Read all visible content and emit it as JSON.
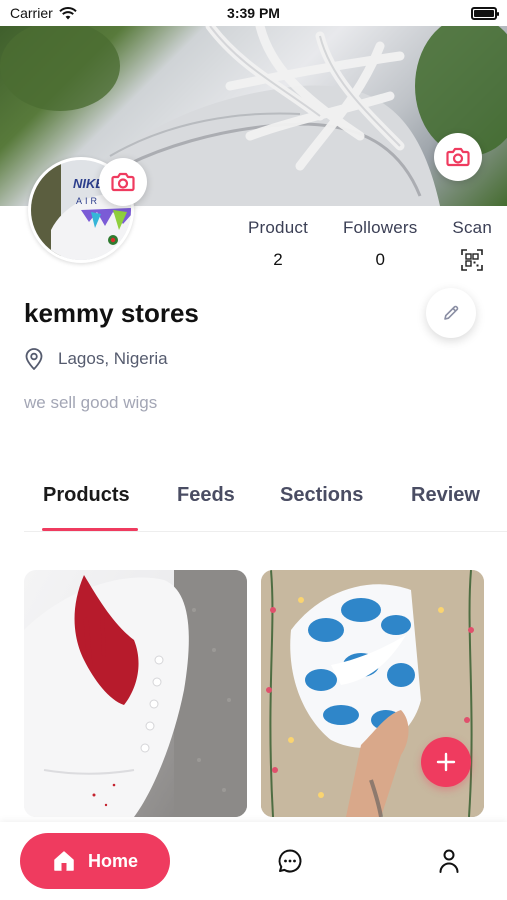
{
  "status_bar": {
    "carrier": "Carrier",
    "time": "3:39 PM"
  },
  "profile": {
    "store_name": "kemmy stores",
    "location": "Lagos, Nigeria",
    "bio": "we sell good wigs",
    "avatar_brand_text": "NIKE AIR"
  },
  "stats": [
    {
      "label": "Product",
      "value": "2"
    },
    {
      "label": "Followers",
      "value": "0"
    },
    {
      "label": "Scan",
      "icon": "qr-scan-icon"
    }
  ],
  "tabs": [
    {
      "label": "Products",
      "active": true
    },
    {
      "label": "Feeds",
      "active": false
    },
    {
      "label": "Sections",
      "active": false
    },
    {
      "label": "Review",
      "active": false
    }
  ],
  "products": [
    {
      "image": "white-sneaker-red-swoosh"
    },
    {
      "image": "blue-cloud-high-top-sneaker"
    }
  ],
  "bottom_nav": {
    "home_label": "Home",
    "items": [
      "home-icon",
      "chat-icon",
      "profile-icon"
    ]
  },
  "colors": {
    "accent": "#ef3b5f",
    "text_primary": "#111111",
    "text_secondary": "#3b3f55",
    "text_muted": "#a3a6b5"
  }
}
